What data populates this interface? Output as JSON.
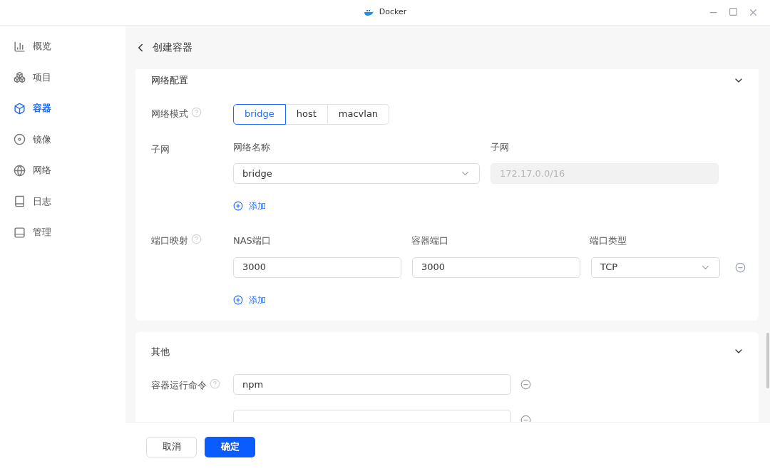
{
  "window": {
    "title": "Docker"
  },
  "sidebar": {
    "items": [
      {
        "label": "概览",
        "selected": false
      },
      {
        "label": "项目",
        "selected": false
      },
      {
        "label": "容器",
        "selected": true
      },
      {
        "label": "镜像",
        "selected": false
      },
      {
        "label": "网络",
        "selected": false
      },
      {
        "label": "日志",
        "selected": false
      },
      {
        "label": "管理",
        "selected": false
      }
    ]
  },
  "page": {
    "title": "创建容器"
  },
  "network_section": {
    "title": "网络配置",
    "expanded": true,
    "mode": {
      "label": "网络模式",
      "options": [
        {
          "label": "bridge",
          "selected": true
        },
        {
          "label": "host",
          "selected": false
        },
        {
          "label": "macvlan",
          "selected": false
        }
      ]
    },
    "subnet": {
      "label": "子网",
      "name_label": "网络名称",
      "name_value": "bridge",
      "subnet_label": "子网",
      "subnet_value": "172.17.0.0/16",
      "add": "添加"
    },
    "ports": {
      "label": "端口映射",
      "columns": [
        "NAS端口",
        "容器端口",
        "端口类型"
      ],
      "rows": [
        {
          "nas": "3000",
          "container": "3000",
          "type": "TCP"
        }
      ],
      "add": "添加"
    }
  },
  "other_section": {
    "title": "其他",
    "expanded": true,
    "command": {
      "label": "容器运行命令",
      "rows": [
        {
          "kind": "filled",
          "value": "npm"
        },
        {
          "kind": "cut"
        }
      ]
    }
  },
  "footer": {
    "cancel": "取消",
    "confirm": "确定"
  }
}
